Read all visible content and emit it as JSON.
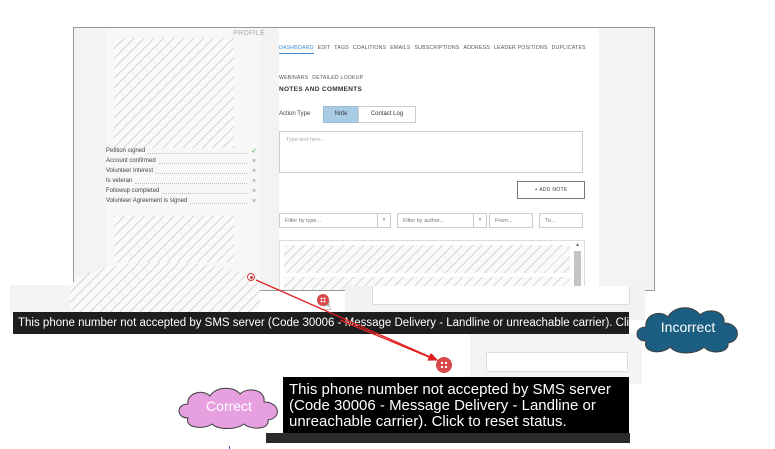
{
  "profile": {
    "label": "PROFILE",
    "checklist": [
      {
        "label": "Petition signed",
        "status": "yes"
      },
      {
        "label": "Account confirmed",
        "status": "no"
      },
      {
        "label": "Volunteer Interest",
        "status": "no"
      },
      {
        "label": "Is veteran",
        "status": "no"
      },
      {
        "label": "Followup completed",
        "status": "no"
      },
      {
        "label": "Volunteer Agreement is signed",
        "status": "no"
      }
    ],
    "check_glyph": "✓",
    "cross_glyph": "×"
  },
  "tabs": {
    "row1": [
      "DASHBOARD",
      "EDIT",
      "TAGS",
      "COALITIONS",
      "EMAILS",
      "SUBSCRIPTIONS",
      "ADDRESS",
      "LEADER POSITIONS",
      "DUPLICATES"
    ],
    "row2": [
      "WEBINARS",
      "DETAILED LOOKUP"
    ],
    "active": "DASHBOARD"
  },
  "notes": {
    "title": "NOTES AND COMMENTS",
    "action_type_label": "Action Type",
    "note_option": "Note",
    "contact_log_option": "Contact Log",
    "textarea_placeholder": "Type text here...",
    "add_note_label": "+ ADD NOTE"
  },
  "filters": {
    "type_placeholder": "Filter by type...",
    "author_placeholder": "Filter by author...",
    "from_placeholder": "From...",
    "to_placeholder": "To..."
  },
  "tooltips": {
    "incorrect_text": "This phone number not accepted by SMS server (Code 30006 - Message Delivery - Landline or unreachable carrier). Click to reset status.",
    "correct_lines": [
      "This phone number not accepted by SMS server",
      "(Code 30006 - Message Delivery - Landline or",
      "unreachable carrier). Click to reset status."
    ]
  },
  "annotations": {
    "incorrect_label": "Incorrect",
    "correct_label": "Correct",
    "incorrect_cloud_color": "#1b5e82",
    "correct_cloud_color": "#e6a0e0",
    "arrow_color": "#e02020"
  }
}
